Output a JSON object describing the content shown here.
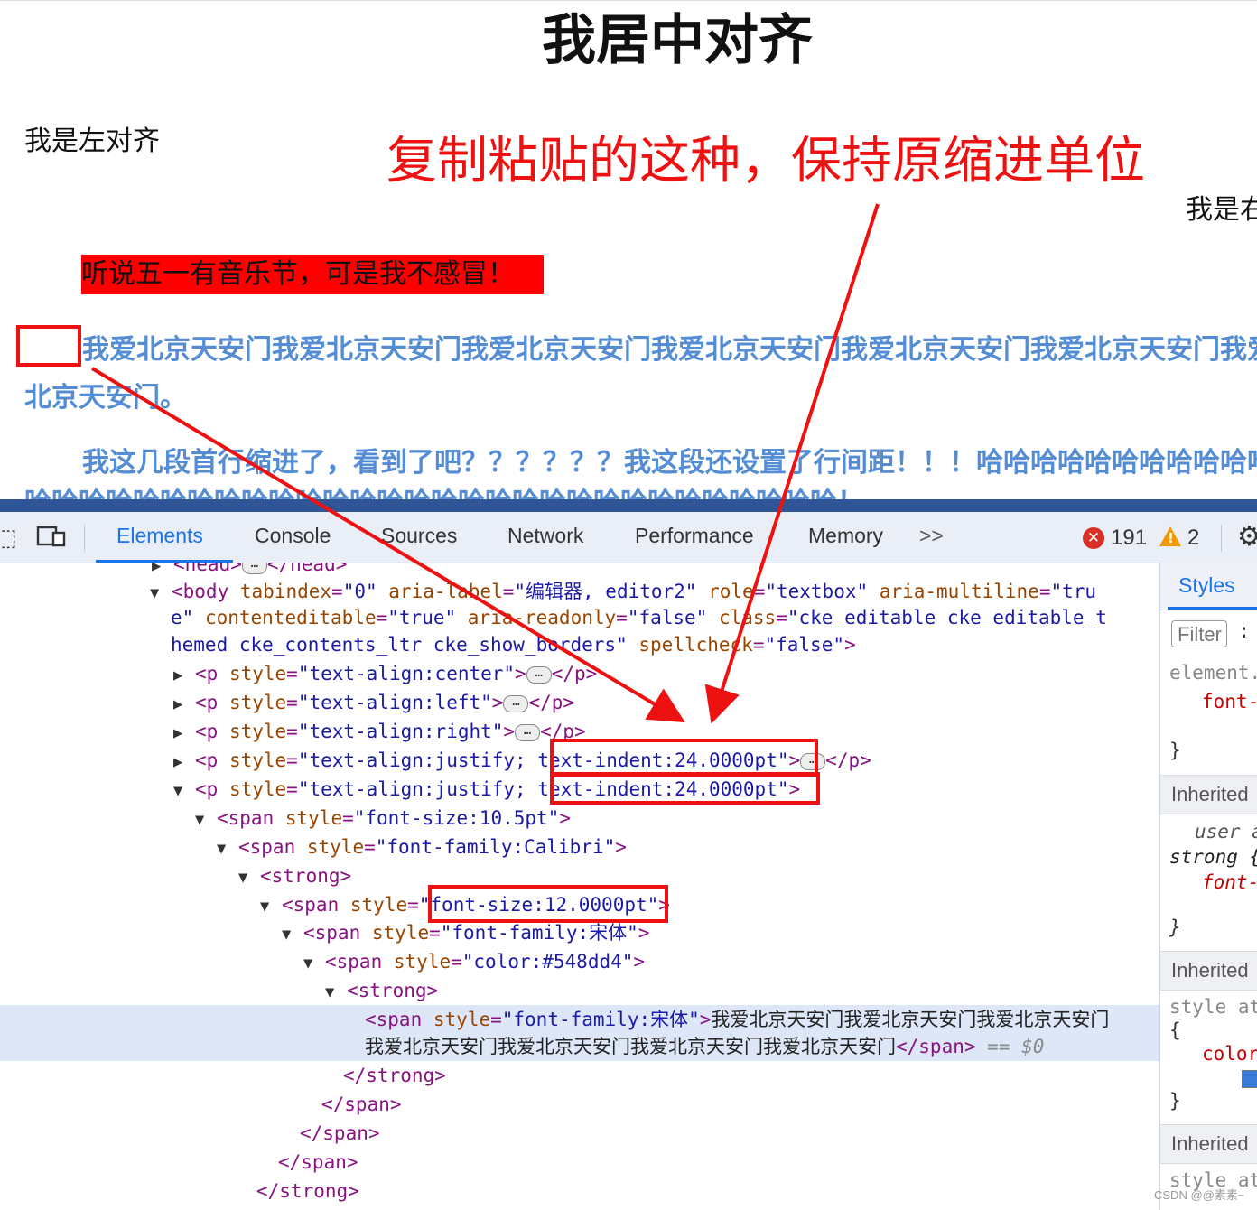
{
  "page": {
    "center": "我居中对齐",
    "left": "我是左对齐",
    "right": "我是右对齐",
    "highlight": "听说五一有音乐节，可是我不感冒！",
    "paragraph1": "我爱北京天安门我爱北京天安门我爱北京天安门我爱北京天安门我爱北京天安门我爱北京天安门我爱北京天安门。",
    "paragraph2": "我这几段首行缩进了，看到了吧？？？？？？我这段还设置了行间距！！！哈哈哈哈哈哈哈哈哈哈哈哈哈哈哈哈哈哈哈哈哈哈哈哈哈哈哈哈哈哈哈哈哈哈哈哈哈哈哈哈哈！"
  },
  "annotation": {
    "text": "复制粘贴的这种，保持原缩进单位",
    "color": "#ee1111"
  },
  "devtools": {
    "tabs": [
      "Elements",
      "Console",
      "Sources",
      "Network",
      "Performance",
      "Memory"
    ],
    "more": ">>",
    "active_tab": "Elements",
    "error_count": "191",
    "warning_count": "2",
    "icons": [
      "inspect-icon",
      "device-toggle-icon",
      "error-icon",
      "warning-icon",
      "gear-icon"
    ]
  },
  "dom": {
    "head_line": {
      "open": "<head>",
      "close": "</head>"
    },
    "body": {
      "tag": "<body",
      "a1n": "tabindex",
      "a1v": "\"0\"",
      "a2n": "aria-label",
      "a2v": "\"编辑器, editor2\"",
      "a3n": "role",
      "a3v": "\"textbox\"",
      "a4n": "aria-multiline",
      "a4v": "\"tru",
      "a4v2": "e\"",
      "a5n": "contenteditable",
      "a5v": "\"true\"",
      "a6n": "aria-readonly",
      "a6v": "\"false\"",
      "a7n": "class",
      "a7v": "\"cke_editable cke_editable_t",
      "a7v2": "hemed cke_contents_ltr cke_show_borders\"",
      "a8n": "spellcheck",
      "a8v": "\"false\"",
      "end": ">"
    },
    "p_center": {
      "tag": "<p",
      "an": "style",
      "av": "\"text-align:center\"",
      "close": "</p>"
    },
    "p_left": {
      "tag": "<p",
      "an": "style",
      "av": "\"text-align:left\"",
      "close": "</p>"
    },
    "p_right": {
      "tag": "<p",
      "an": "style",
      "av": "\"text-align:right\"",
      "close": "</p>"
    },
    "p_justify1": {
      "tag": "<p",
      "an": "style",
      "av1": "\"text-align:justify; ",
      "av2": "text-indent:24.0000pt",
      "av3": "\"",
      "close": "</p>"
    },
    "p_justify2": {
      "tag": "<p",
      "an": "style",
      "av1": "\"text-align:justify; ",
      "av2": "text-indent:24.0000pt",
      "av3": "\"",
      "end": ">"
    },
    "span1": {
      "tag": "<span",
      "an": "style",
      "av": "\"font-size:10.5pt\"",
      "end": ">"
    },
    "span2": {
      "tag": "<span",
      "an": "style",
      "av": "\"font-family:Calibri\"",
      "end": ">"
    },
    "strong1": "<strong>",
    "span3": {
      "tag": "<span",
      "an": "style",
      "av1": "\"",
      "av2": "font-size:12.0000pt",
      "av3": "\"",
      "end": ">"
    },
    "span4": {
      "tag": "<span",
      "an": "style",
      "av": "\"font-family:宋体\"",
      "end": ">"
    },
    "span5": {
      "tag": "<span",
      "an": "style",
      "av": "\"color:#548dd4\"",
      "end": ">"
    },
    "strong2": "<strong>",
    "selected": {
      "tag": "<span",
      "an": "style",
      "av": "\"font-family:宋体\"",
      "end": ">",
      "text1": "我爱北京天安门我爱北京天安门我爱北京天安门",
      "text2": "我爱北京天安门我爱北京天安门我爱北京天安门我爱北京天安门",
      "close": "</span>",
      "eq": "==",
      "ref": "$0"
    },
    "close_strong2": "</strong>",
    "close_span5": "</span>",
    "close_span4": "</span>",
    "close_span3": "</span>",
    "close_strong1": "</strong>"
  },
  "styles_panel": {
    "tab": "Styles",
    "filter_placeholder": "Filter",
    "element": "element.",
    "font_prop": "font-",
    "brace_close": "}",
    "inherited1": "Inherited",
    "user_agent": "user a",
    "strong_sel": "strong {",
    "font_prop2": "font-",
    "inherited2": "Inherited",
    "style_attr": "style at",
    "brace_open": "{",
    "color_prop": "color",
    "inherited3": "Inherited",
    "style_attr2": "style at",
    "swatch_color": "#3b7bd8"
  },
  "watermark": "CSDN @@素素~"
}
